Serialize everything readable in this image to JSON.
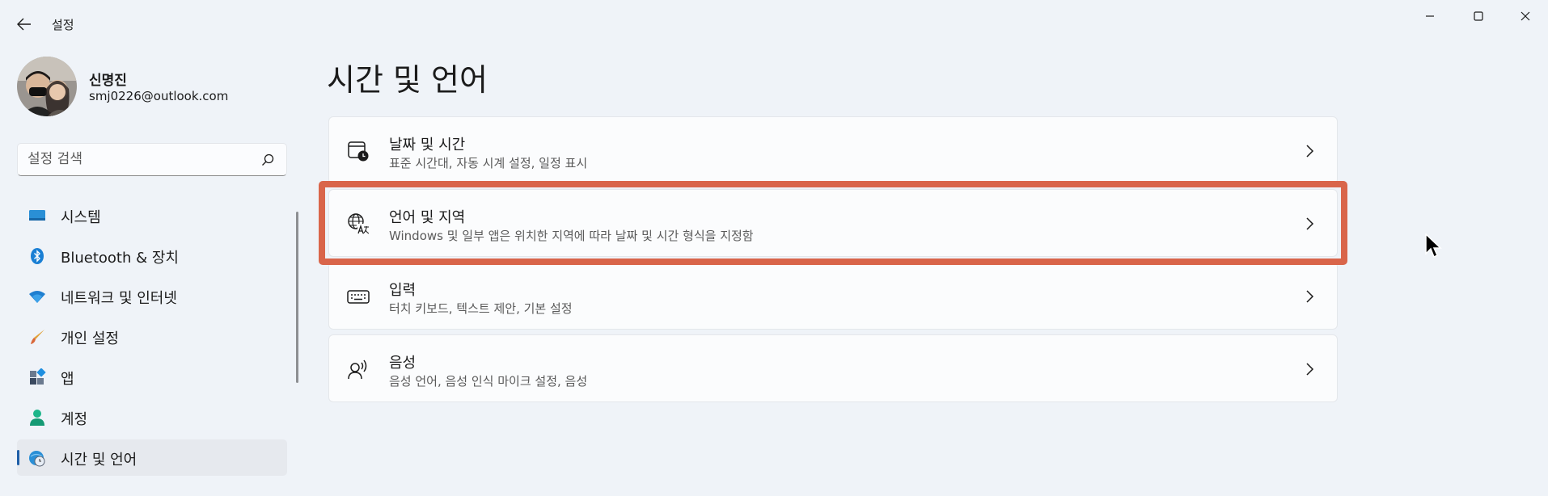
{
  "window": {
    "title": "설정",
    "controls": {
      "minimize": "minimize",
      "maximize": "maximize",
      "close": "close"
    }
  },
  "user": {
    "name": "신명진",
    "email": "smj0226@outlook.com"
  },
  "search": {
    "placeholder": "설정 검색"
  },
  "sidebar": {
    "items": [
      {
        "label": "시스템",
        "icon": "system-icon",
        "active": false
      },
      {
        "label": "Bluetooth & 장치",
        "icon": "bluetooth-icon",
        "active": false
      },
      {
        "label": "네트워크 및 인터넷",
        "icon": "wifi-icon",
        "active": false
      },
      {
        "label": "개인 설정",
        "icon": "brush-icon",
        "active": false
      },
      {
        "label": "앱",
        "icon": "apps-icon",
        "active": false
      },
      {
        "label": "계정",
        "icon": "account-icon",
        "active": false
      },
      {
        "label": "시간 및 언어",
        "icon": "time-language-icon",
        "active": true
      }
    ]
  },
  "main": {
    "title": "시간 및 언어",
    "cards": [
      {
        "title": "날짜 및 시간",
        "subtitle": "표준 시간대, 자동 시계 설정, 일정 표시",
        "icon": "calendar-clock-icon"
      },
      {
        "title": "언어 및 지역",
        "subtitle": "Windows 및 일부 앱은 위치한 지역에 따라 날짜 및 시간 형식을 지정함",
        "icon": "globe-language-icon",
        "highlighted": true
      },
      {
        "title": "입력",
        "subtitle": "터치 키보드, 텍스트 제안, 기본 설정",
        "icon": "keyboard-icon"
      },
      {
        "title": "음성",
        "subtitle": "음성 언어, 음성 인식 마이크 설정, 음성",
        "icon": "speech-icon"
      }
    ]
  },
  "colors": {
    "accent": "#1f5fa8",
    "highlight": "#d9654a",
    "background": "#eff3f8",
    "card": "#fbfcfd"
  }
}
